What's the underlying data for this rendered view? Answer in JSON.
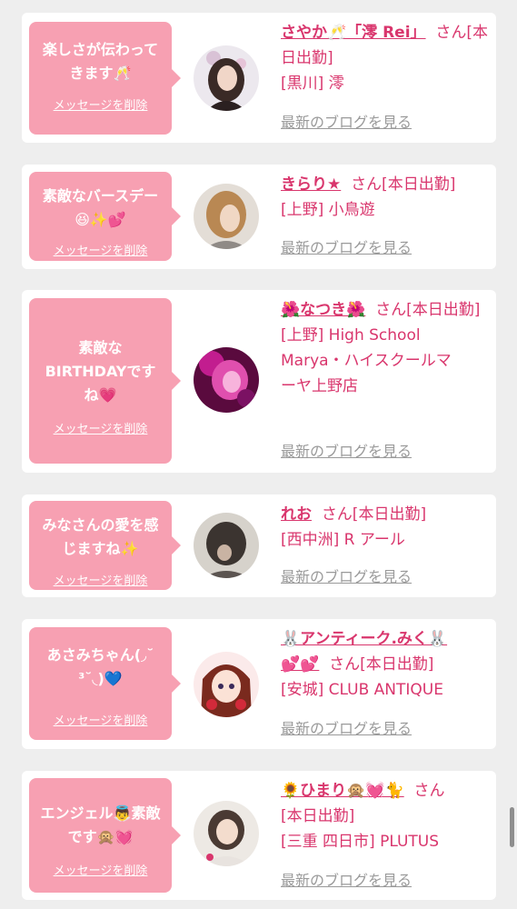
{
  "colors": {
    "bubble": "#f7a0b2",
    "accent": "#d9366d",
    "muted": "#9a9a9a",
    "background": "#eeeeee"
  },
  "delete_label": "メッセージを削除",
  "blog_label": "最新のブログを見る",
  "cards": [
    {
      "message_lines": [
        "楽しさが伝わって",
        "きます🥂"
      ],
      "name": "さやか🥂「澪 Rei」",
      "suffix": "さん[本日出勤]",
      "shop_lines": [
        "[黒川] 澪"
      ],
      "avatar": "woman-portrait"
    },
    {
      "message_lines": [
        "素敵なバースデー",
        "😆✨💕"
      ],
      "name": "きらり★",
      "suffix": "さん[本日出勤]",
      "shop_lines": [
        "[上野] 小鳥遊"
      ],
      "avatar": "woman-blonde-hair"
    },
    {
      "message_lines": [
        "素敵な",
        "BIRTHDAYです",
        "ね💗"
      ],
      "name": "🌺なつき🌺",
      "suffix": "さん[本日出勤]",
      "shop_lines": [
        "[上野] High School",
        "Marya・ハイスクールマ",
        "ーヤ上野店"
      ],
      "avatar": "woman-pink-light"
    },
    {
      "message_lines": [
        "みなさんの愛を感",
        "じますね✨"
      ],
      "name": "れお",
      "suffix": "さん[本日出勤]",
      "shop_lines": [
        "[西中洲] R アール"
      ],
      "avatar": "woman-dark-hair"
    },
    {
      "message_lines": [
        "あさみちゃん(◞˘",
        "³˘◟)💙"
      ],
      "name": "🐰アンティーク.みく🐰",
      "name2": "💕💕",
      "suffix": "さん[本日出勤]",
      "shop_lines": [
        "[安城] CLUB ANTIQUE"
      ],
      "avatar": "anime-girl"
    },
    {
      "message_lines": [
        "エンジェル👼素敵",
        "です🙊💓"
      ],
      "name": "🌻ひまり🙊💓🐈",
      "suffix": "さん",
      "suffix2": "[本日出勤]",
      "shop_lines": [
        "[三重 四日市] PLUTUS"
      ],
      "avatar": "woman-selfie"
    }
  ]
}
